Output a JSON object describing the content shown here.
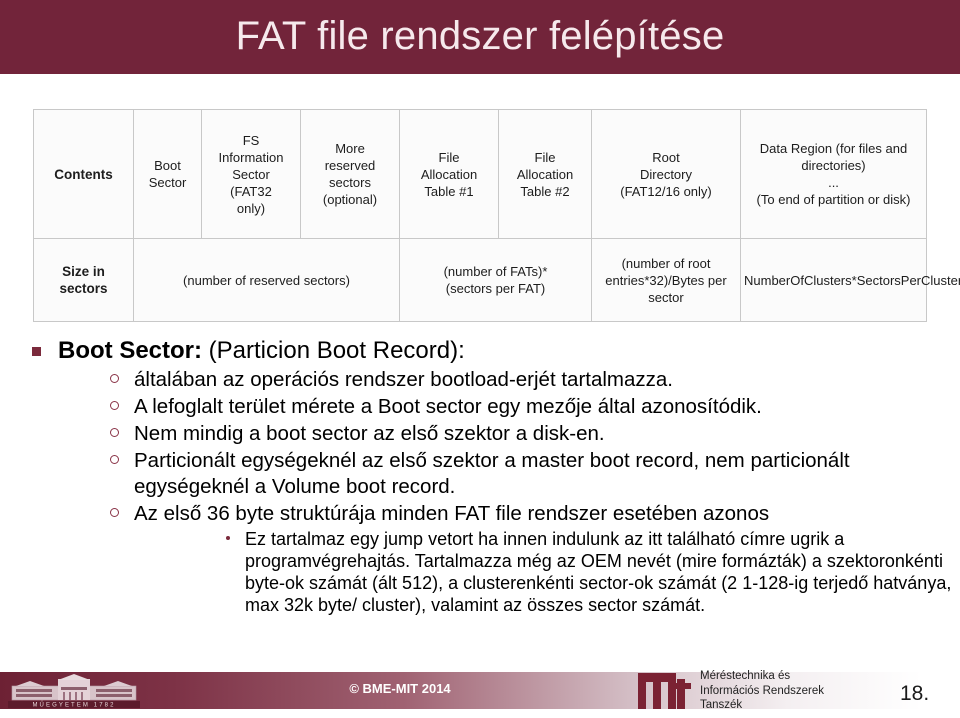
{
  "slide": {
    "title": "FAT file rendszer felépítése",
    "accent_color": "#72243a",
    "title_text_color": "#f6e9ec"
  },
  "fat_table": {
    "row1_header": "Contents",
    "row1_cells": [
      "Boot\nSector",
      "FS\nInformation\nSector\n(FAT32\nonly)",
      "More\nreserved\nsectors\n(optional)",
      "File\nAllocation\nTable #1",
      "File\nAllocation\nTable #2",
      "Root\nDirectory\n(FAT12/16 only)",
      "Data Region (for files and directories)\n...\n(To end of partition or disk)"
    ],
    "row2_header": "Size in\nsectors",
    "row2_cells": [
      "(number of reserved sectors)",
      "(number of FATs)*\n(sectors per FAT)",
      "(number of root\nentries*32)/Bytes per\nsector",
      "NumberOfClusters*SectorsPerCluster"
    ]
  },
  "bullets": {
    "b1_prefix": "Boot Sector:",
    "b1_rest": " (Particion Boot Record):",
    "level2": [
      "általában az operációs rendszer bootload-erjét tartalmazza.",
      "A lefoglalt terület mérete a Boot sector egy mezője által azonosítódik.",
      "Nem mindig a boot sector az első szektor a disk-en.",
      "Particionált egységeknél az első szektor a master boot record, nem particionált egységeknél a Volume boot record.",
      "Az első 36 byte struktúrája minden FAT file rendszer esetében azonos"
    ],
    "level3": [
      "Ez tartalmaz egy jump vetort ha innen indulunk az itt található címre ugrik a programvégrehajtás. Tartalmazza még az OEM nevét (mire formázták) a szektoronkénti byte-ok számát (ált 512), a clusterenkénti sector-ok számát (2 1-128-ig terjedő hatványa, max 32k byte/ cluster), valamint az összes sector számát."
    ]
  },
  "footer": {
    "copyright": "© BME-MIT 2014",
    "department_line1": "Méréstechnika és",
    "department_line2": "Információs Rendszerek",
    "department_line3": "Tanszék",
    "page_number": "18.",
    "bme_logo_caption": "MŰEGYETEM 1782",
    "mit_logo_text": "mit"
  }
}
